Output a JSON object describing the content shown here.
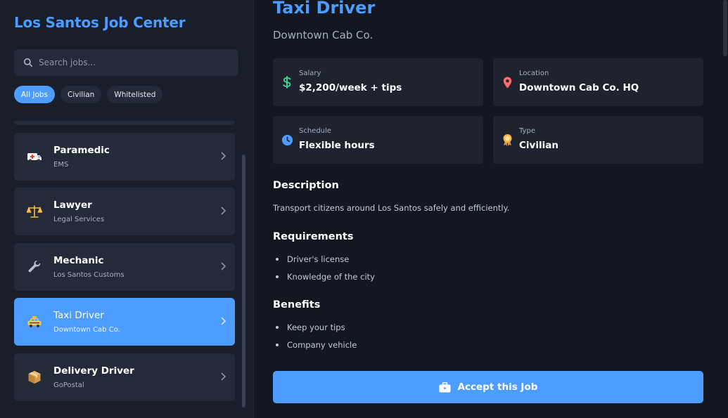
{
  "sidebar": {
    "brand": "Los Santos Job Center",
    "search": {
      "placeholder": "Search jobs...",
      "value": ""
    },
    "filters": [
      "All Jobs",
      "Civilian",
      "Whitelisted"
    ],
    "active_filter": "All Jobs",
    "jobs": [
      {
        "title": "Paramedic",
        "sub": "EMS",
        "icon": "ambulance-icon"
      },
      {
        "title": "Lawyer",
        "sub": "Legal Services",
        "icon": "scales-icon"
      },
      {
        "title": "Mechanic",
        "sub": "Los Santos Customs",
        "icon": "wrench-icon"
      },
      {
        "title": "Taxi Driver",
        "sub": "Downtown Cab Co.",
        "icon": "taxi-icon",
        "active": true
      },
      {
        "title": "Delivery Driver",
        "sub": "GoPostal",
        "icon": "package-icon"
      }
    ]
  },
  "detail": {
    "title": "Taxi Driver",
    "company": "Downtown Cab Co.",
    "info": {
      "salary": {
        "label": "Salary",
        "value": "$2,200/week + tips"
      },
      "location": {
        "label": "Location",
        "value": "Downtown Cab Co. HQ"
      },
      "schedule": {
        "label": "Schedule",
        "value": "Flexible hours"
      },
      "type": {
        "label": "Type",
        "value": "Civilian"
      }
    },
    "description_heading": "Description",
    "description": "Transport citizens around Los Santos safely and efficiently.",
    "requirements_heading": "Requirements",
    "requirements": [
      "Driver's license",
      "Knowledge of the city"
    ],
    "benefits_heading": "Benefits",
    "benefits": [
      "Keep your tips",
      "Company vehicle"
    ],
    "accept_label": "Accept this Job"
  },
  "colors": {
    "accent": "#4d9cff",
    "salary_icon": "#3ecf8e",
    "location_icon": "#ff6b6b",
    "schedule_icon": "#4d9cff",
    "type_icon": "#f5b942"
  }
}
